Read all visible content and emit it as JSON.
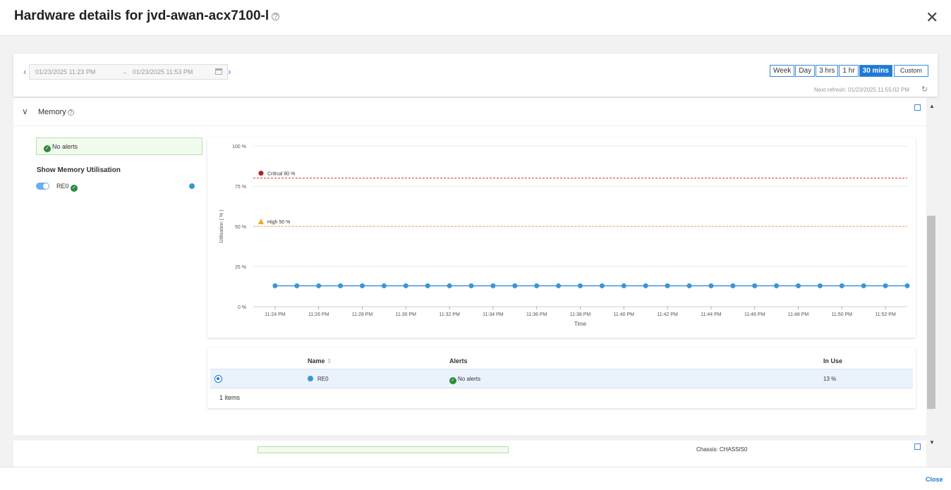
{
  "header": {
    "title": "Hardware details for jvd-awan-acx7100-l",
    "help_icon": "question-circle-icon",
    "close_icon": "close-icon"
  },
  "toolbar": {
    "date_start": "01/23/2025 11:23 PM",
    "date_arrow": "→",
    "date_end": "01/23/2025 11:53 PM",
    "prev": "‹",
    "next": "›",
    "ranges": [
      "Week",
      "Day",
      "3 hrs",
      "1 hr",
      "30 mins"
    ],
    "active_range": "30 mins",
    "custom_label": "Custom",
    "next_refresh": "Next refresh: 01/23/2025 11:55:02 PM"
  },
  "memory": {
    "title": "Memory",
    "no_alerts": "No alerts",
    "show_label": "Show Memory Utilisation",
    "series_label": "RE0",
    "series_color": "#3a96d3"
  },
  "chart_data": {
    "type": "line",
    "ylabel": "Utilisation ( % )",
    "xlabel": "Time",
    "y_ticks": [
      "100 %",
      "75 %",
      "50 %",
      "25 %",
      "0 %"
    ],
    "y_tick_values": [
      100,
      75,
      50,
      25,
      0
    ],
    "ylim": [
      0,
      100
    ],
    "x_ticks": [
      "11:24 PM",
      "11:26 PM",
      "11:28 PM",
      "11:30 PM",
      "11:32 PM",
      "11:34 PM",
      "11:36 PM",
      "11:38 PM",
      "11:40 PM",
      "11:42 PM",
      "11:44 PM",
      "11:46 PM",
      "11:48 PM",
      "11:50 PM",
      "11:52 PM"
    ],
    "x_range_minutes": [
      "11:23 PM",
      "11:53 PM"
    ],
    "series": [
      {
        "name": "RE0",
        "color": "#3a96d3",
        "x": [
          "11:24 PM",
          "11:25 PM",
          "11:26 PM",
          "11:27 PM",
          "11:28 PM",
          "11:29 PM",
          "11:30 PM",
          "11:31 PM",
          "11:32 PM",
          "11:33 PM",
          "11:34 PM",
          "11:35 PM",
          "11:36 PM",
          "11:37 PM",
          "11:38 PM",
          "11:39 PM",
          "11:40 PM",
          "11:41 PM",
          "11:42 PM",
          "11:43 PM",
          "11:44 PM",
          "11:45 PM",
          "11:46 PM",
          "11:47 PM",
          "11:48 PM",
          "11:49 PM",
          "11:50 PM",
          "11:51 PM",
          "11:52 PM",
          "11:53 PM"
        ],
        "values": [
          13,
          13,
          13,
          13,
          13,
          13,
          13,
          13,
          13,
          13,
          13,
          13,
          13,
          13,
          13,
          13,
          13,
          13,
          13,
          13,
          13,
          13,
          13,
          13,
          13,
          13,
          13,
          13,
          13,
          13
        ]
      }
    ],
    "thresholds": [
      {
        "label": "Critical 80 %",
        "value": 80,
        "color": "#d9302c"
      },
      {
        "label": "High 50 %",
        "value": 50,
        "color": "#e6a24a"
      }
    ],
    "grid": true
  },
  "table": {
    "columns": [
      "Name",
      "Alerts",
      "In Use"
    ],
    "rows": [
      {
        "name": "RE0",
        "alerts": "No alerts",
        "in_use": "13 %"
      }
    ],
    "items": "1 items"
  },
  "next_panel": {
    "chassis": "Chassis: CHASSIS0"
  },
  "footer": {
    "close": "Close"
  }
}
